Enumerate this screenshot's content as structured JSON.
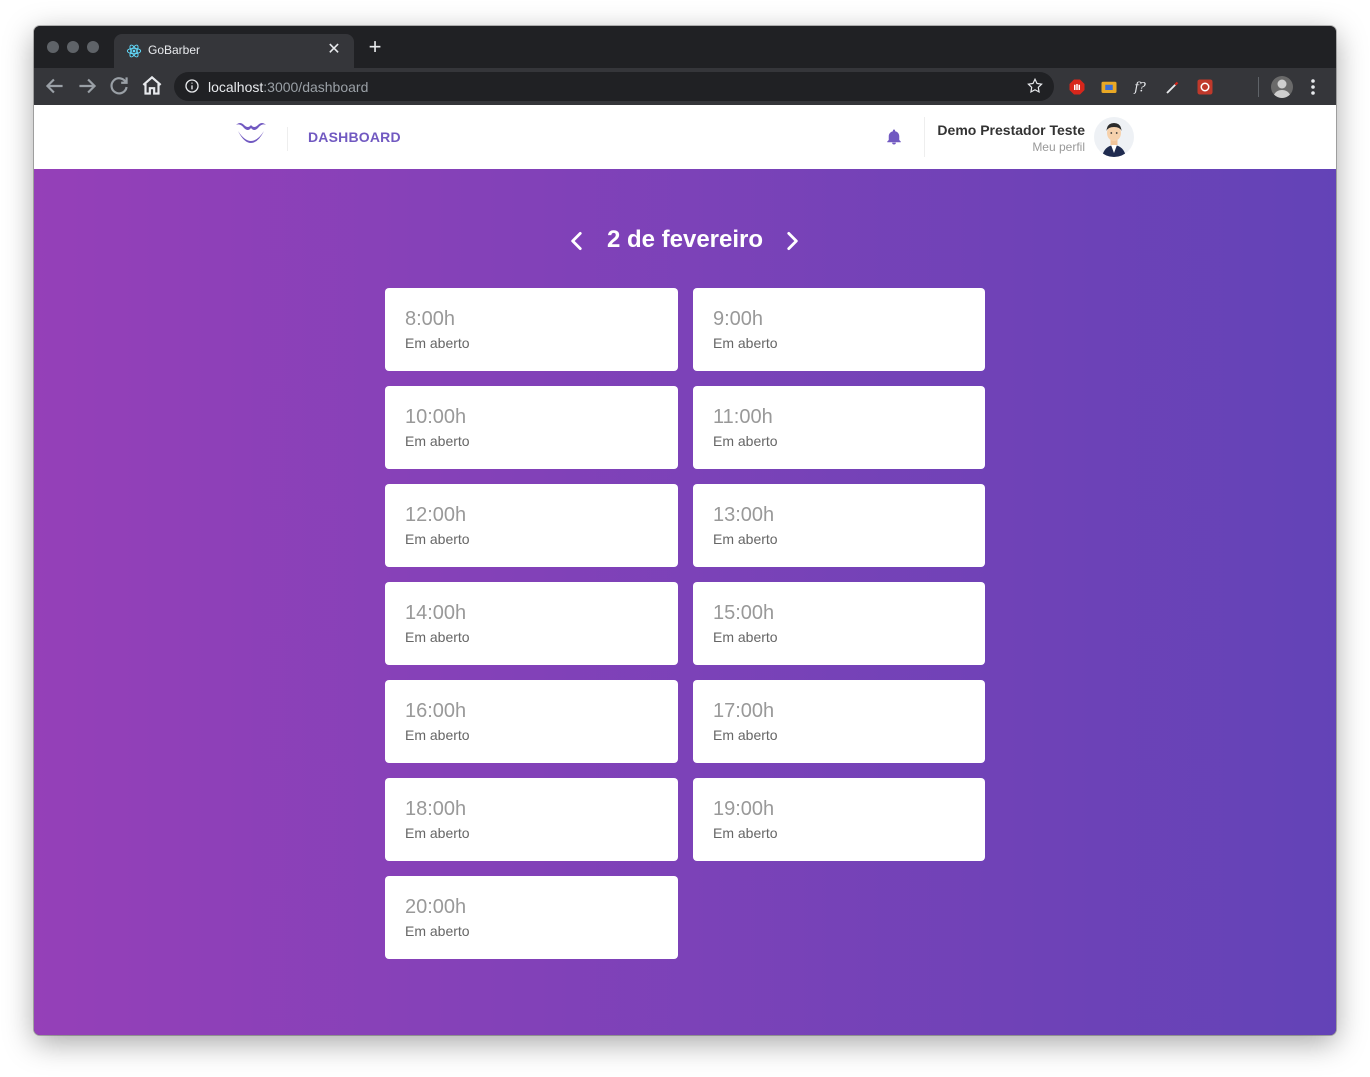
{
  "browser": {
    "tab_title": "GoBarber",
    "url_host": "localhost",
    "url_rest": ":3000/dashboard"
  },
  "header": {
    "nav_label": "DASHBOARD",
    "user_name": "Demo Prestador Teste",
    "profile_link": "Meu perfil"
  },
  "dashboard": {
    "date_label": "2 de fevereiro",
    "slots": [
      {
        "time": "8:00h",
        "status": "Em aberto"
      },
      {
        "time": "9:00h",
        "status": "Em aberto"
      },
      {
        "time": "10:00h",
        "status": "Em aberto"
      },
      {
        "time": "11:00h",
        "status": "Em aberto"
      },
      {
        "time": "12:00h",
        "status": "Em aberto"
      },
      {
        "time": "13:00h",
        "status": "Em aberto"
      },
      {
        "time": "14:00h",
        "status": "Em aberto"
      },
      {
        "time": "15:00h",
        "status": "Em aberto"
      },
      {
        "time": "16:00h",
        "status": "Em aberto"
      },
      {
        "time": "17:00h",
        "status": "Em aberto"
      },
      {
        "time": "18:00h",
        "status": "Em aberto"
      },
      {
        "time": "19:00h",
        "status": "Em aberto"
      },
      {
        "time": "20:00h",
        "status": "Em aberto"
      }
    ]
  },
  "colors": {
    "brand": "#7159c1",
    "gradient_start": "#9540b8",
    "gradient_end": "#6343b7"
  }
}
